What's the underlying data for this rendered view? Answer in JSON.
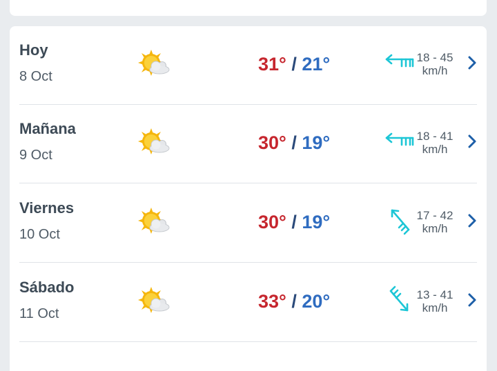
{
  "forecast": [
    {
      "day": "Hoy",
      "date": "8 Oct",
      "icon": "sun-cloud-icon",
      "max": "31°",
      "min": "21°",
      "sep": "/",
      "wind": "18 - 45",
      "unit": "km/h",
      "wind_dir": "wind-arrow-west-icon"
    },
    {
      "day": "Mañana",
      "date": "9 Oct",
      "icon": "sun-cloud-icon",
      "max": "30°",
      "min": "19°",
      "sep": "/",
      "wind": "18 - 41",
      "unit": "km/h",
      "wind_dir": "wind-arrow-west-icon"
    },
    {
      "day": "Viernes",
      "date": "10 Oct",
      "icon": "sun-cloud-icon",
      "max": "30°",
      "min": "19°",
      "sep": "/",
      "wind": "17 - 42",
      "unit": "km/h",
      "wind_dir": "wind-arrow-northwest-icon"
    },
    {
      "day": "Sábado",
      "date": "11 Oct",
      "icon": "sun-cloud-icon",
      "max": "33°",
      "min": "20°",
      "sep": "/",
      "wind": "13 - 41",
      "unit": "km/h",
      "wind_dir": "wind-arrow-southeast-icon"
    }
  ],
  "colors": {
    "max_temp": "#c6262e",
    "min_temp": "#2f6cc0",
    "wind_icon": "#1cc6d6",
    "chevron": "#1d5fa8"
  }
}
